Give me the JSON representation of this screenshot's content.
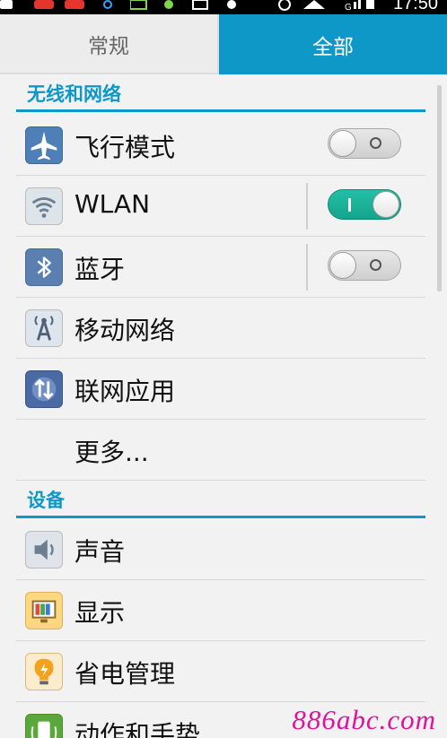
{
  "status_bar": {
    "time": "17:50",
    "signal_label": "G",
    "icons": [
      "notification-icon",
      "app-icon",
      "app-icon",
      "link-icon",
      "message-icon",
      "sync-icon",
      "usb-icon",
      "alarm-icon",
      "wifi-icon",
      "signal-icon",
      "battery-icon"
    ]
  },
  "tabs": [
    {
      "label": "常规",
      "selected": false
    },
    {
      "label": "全部",
      "selected": true
    }
  ],
  "sections": {
    "wireless": {
      "title": "无线和网络",
      "items": [
        {
          "label": "飞行模式",
          "icon": "airplane-icon",
          "toggle": "off"
        },
        {
          "label": "WLAN",
          "icon": "wifi-icon",
          "toggle": "on"
        },
        {
          "label": "蓝牙",
          "icon": "bluetooth-icon",
          "toggle": "off"
        },
        {
          "label": "移动网络",
          "icon": "mobile-network-icon"
        },
        {
          "label": "联网应用",
          "icon": "network-apps-icon"
        },
        {
          "label": "更多..."
        }
      ]
    },
    "device": {
      "title": "设备",
      "items": [
        {
          "label": "声音",
          "icon": "sound-icon"
        },
        {
          "label": "显示",
          "icon": "display-icon"
        },
        {
          "label": "省电管理",
          "icon": "power-saving-icon"
        },
        {
          "label": "动作和手势",
          "icon": "motion-gesture-icon"
        }
      ]
    }
  },
  "watermark": "886abc.com",
  "colors": {
    "accent": "#0e98c8",
    "toggle_on": "#18b39a",
    "background": "#f2f2f2",
    "watermark": "#e0119a"
  }
}
